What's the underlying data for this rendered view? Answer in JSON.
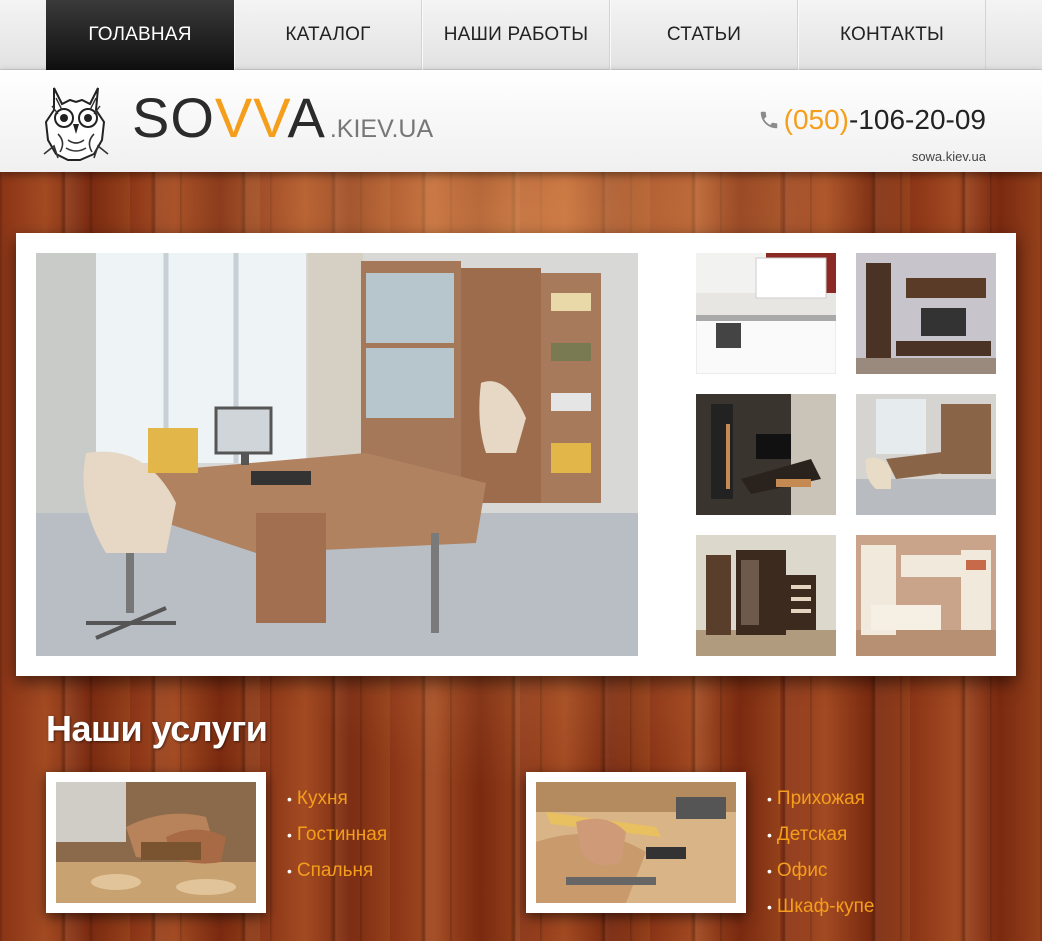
{
  "nav": {
    "items": [
      {
        "label": "ГОЛАВНАЯ",
        "active": true
      },
      {
        "label": "КАТАЛОГ",
        "active": false
      },
      {
        "label": "НАШИ РАБОТЫ",
        "active": false
      },
      {
        "label": "СТАТЬИ",
        "active": false
      },
      {
        "label": "КОНТАКТЫ",
        "active": false
      }
    ]
  },
  "header": {
    "brand_prefix": "SO",
    "brand_accent": "VV",
    "brand_suffix": "A",
    "brand_domain": ".KIEV.UA",
    "phone_code": "(050)",
    "phone_number": "-106-20-09",
    "site_note": "sowa.kiev.ua"
  },
  "services": {
    "title": "Наши услуги",
    "left_items": [
      "Кухня",
      "Гостинная",
      "Спальня"
    ],
    "right_items": [
      "Прихожая",
      "Детская",
      "Офис",
      "Шкаф-купе"
    ]
  },
  "colors": {
    "accent": "#f59e1c",
    "nav_active_bg": "#1a1a1a",
    "wood": "#8a3416"
  },
  "icons": {
    "phone": "phone-icon",
    "logo": "owl-logo-icon"
  }
}
